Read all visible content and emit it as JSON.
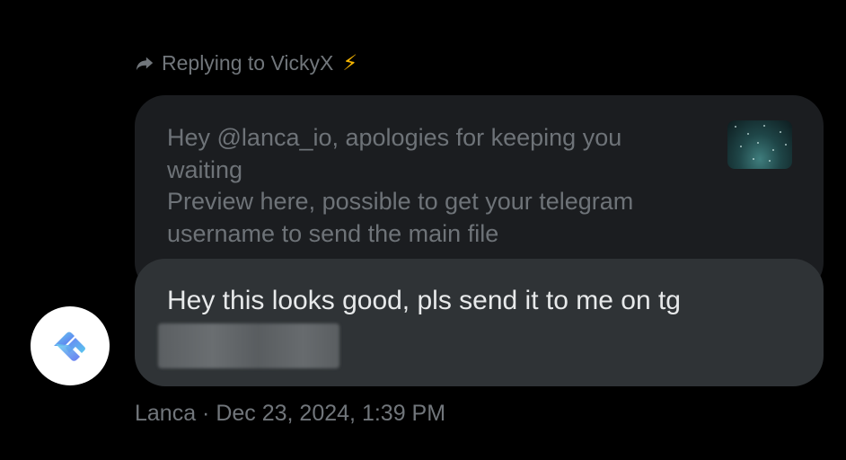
{
  "reply_header": {
    "icon": "reply-arrow-icon",
    "text": "Replying to VickyX",
    "emoji": "⚡"
  },
  "quoted_message": {
    "lines": [
      "Hey @lanca_io, apologies for keeping you",
      "waiting",
      "Preview here, possible to get your telegram",
      "username to send the main file"
    ],
    "thumbnail": "starfield-image-thumbnail"
  },
  "message": {
    "text": "Hey this looks good, pls send it to me on tg",
    "redacted": "blurred-telegram-handle"
  },
  "sender": {
    "avatar": "lanca-logo-avatar",
    "meta": "Lanca · Dec 23, 2024, 1:39 PM"
  },
  "colors": {
    "background": "#000000",
    "quoted_bubble": "#1b1d20",
    "message_bubble": "#2f3336",
    "muted_text": "#71767b",
    "message_text": "#e7e9ea",
    "bolt": "#f5b400"
  }
}
